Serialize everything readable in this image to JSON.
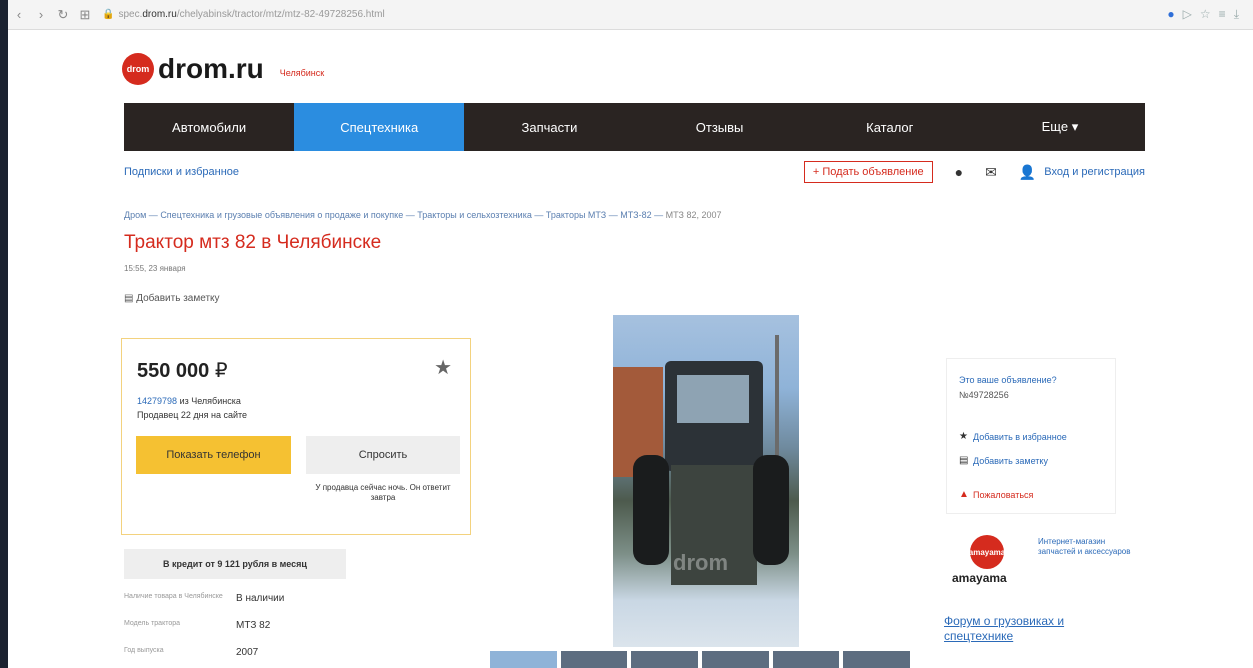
{
  "browser": {
    "url_prefix": "spec.",
    "url_host": "drom.ru",
    "url_path": "/chelyabinsk/tractor/mtz/mtz-82-49728256.html",
    "back": "‹",
    "forward": "›",
    "reload": "↻",
    "grid": "⊞",
    "lock": "🔒",
    "tools": [
      "●",
      "▷",
      "☆",
      "≡",
      "⤓"
    ]
  },
  "header": {
    "logo_mark": "drom",
    "logo": "drom.ru",
    "city": "Челябинск"
  },
  "menu": [
    {
      "label": "Автомобили"
    },
    {
      "label": "Спецтехника"
    },
    {
      "label": "Запчасти"
    },
    {
      "label": "Отзывы"
    },
    {
      "label": "Каталог"
    },
    {
      "label": "Еще ▾"
    }
  ],
  "subbar": {
    "subs": "Подписки и избранное",
    "post": "+ Подать объявление",
    "help_icon": "●",
    "mail_icon": "✉",
    "user_icon": "👤",
    "login": "Вход и регистрация"
  },
  "breadcrumbs": [
    {
      "label": "Дром"
    },
    {
      "label": "Спецтехника и грузовые объявления о продаже и покупке"
    },
    {
      "label": "Тракторы и сельхозтехника"
    },
    {
      "label": "Тракторы МТЗ"
    },
    {
      "label": "МТЗ-82"
    },
    {
      "label": "МТЗ 82, 2007"
    }
  ],
  "crumb_sep": " — ",
  "title": "Трактор мтз 82 в Челябинске",
  "date": "15:55, 23 января",
  "note": "Добавить заметку",
  "note_icon": "▤",
  "price_box": {
    "price": "550 000",
    "currency": "₽",
    "star": "★",
    "seller_id": "14279798",
    "seller_city": "из Челябинска",
    "seller_age": "Продавец 22 дня на сайте",
    "show_phone": "Показать телефон",
    "ask": "Спросить",
    "ask_note": "У продавца сейчас ночь. Он ответит завтра"
  },
  "credit": "В кредит от 9 121 рубля в месяц",
  "specs": [
    {
      "k": "Наличие товара в Челябинске",
      "v": "В наличии"
    },
    {
      "k": "Модель трактора",
      "v": "МТЗ 82"
    },
    {
      "k": "Год выпуска",
      "v": "2007"
    }
  ],
  "photo": {
    "watermark": "drom"
  },
  "aside": {
    "title": "Это ваше объявление?",
    "number": "№49728256",
    "actions": [
      {
        "icon": "★",
        "label": "Добавить в избранное",
        "color": "#2b6ab8"
      },
      {
        "icon": "▤",
        "label": "Добавить заметку",
        "color": "#2b6ab8"
      },
      {
        "icon": "▲",
        "label": "Пожаловаться",
        "color": "#d52b1e"
      }
    ]
  },
  "amayama": {
    "logo_mark": "amayama",
    "name": "amayama",
    "text": "Интернет-магазин запчастей и аксессуаров"
  },
  "forum": "Форум о грузовиках и спецтехнике"
}
